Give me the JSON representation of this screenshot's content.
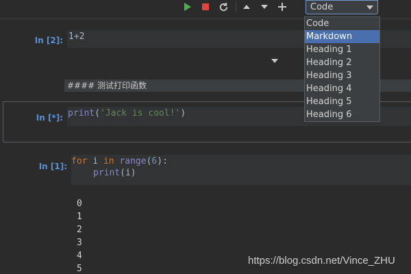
{
  "toolbar": {
    "icons": [
      "run-icon",
      "stop-icon",
      "restart-icon",
      "move-up-icon",
      "move-down-icon",
      "add-cell-icon"
    ],
    "colors": {
      "run": "#4caf50",
      "stop": "#e0443e"
    }
  },
  "cell_type_select": {
    "value": "Code",
    "options": [
      "Code",
      "Markdown",
      "Heading 1",
      "Heading 2",
      "Heading 3",
      "Heading 4",
      "Heading 5",
      "Heading 6"
    ],
    "highlighted": "Markdown"
  },
  "cells": [
    {
      "prompt": "In [2]:",
      "code": "1+2"
    },
    {
      "markdown": "#### 测试打印函数"
    },
    {
      "prompt": "In [*]:",
      "code_fn": "print",
      "code_str": "'Jack is cool!'"
    },
    {
      "prompt": "In [1]:",
      "code_kw_for": "for",
      "code_var": "i",
      "code_kw_in": "in",
      "code_fn": "range",
      "code_num": "6",
      "code_line2_fn": "print",
      "code_line2_arg": "i"
    }
  ],
  "output_lines": [
    "0",
    "1",
    "2",
    "3",
    "4",
    "5"
  ],
  "watermark": "https://blog.csdn.net/Vince_ZHU"
}
